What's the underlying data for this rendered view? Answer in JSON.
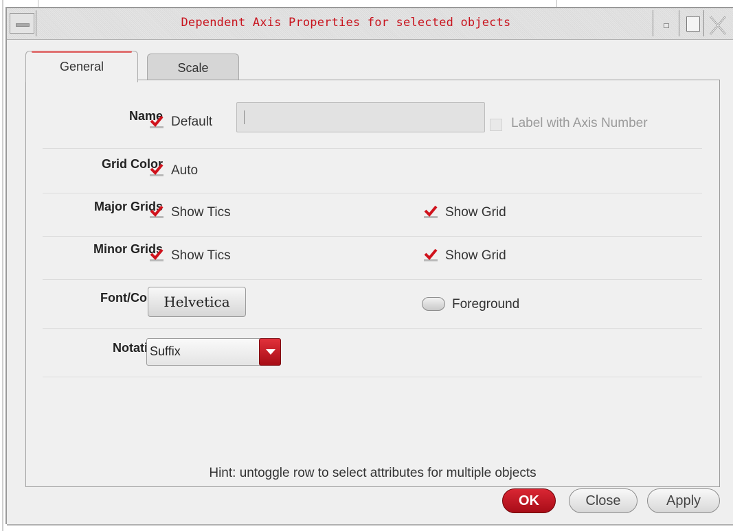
{
  "window": {
    "title": "Dependent Axis Properties for selected objects"
  },
  "tabs": [
    {
      "label": "General",
      "active": true
    },
    {
      "label": "Scale",
      "active": false
    }
  ],
  "form": {
    "name": {
      "label": "Name",
      "default_label": "Default",
      "default_checked": true,
      "value": "",
      "label_with_axis_number": "Label with Axis Number",
      "label_with_axis_number_checked": false,
      "label_with_axis_number_enabled": false
    },
    "grid_color": {
      "label": "Grid Color",
      "auto_label": "Auto",
      "auto_checked": true
    },
    "major_grids": {
      "label": "Major Grids",
      "show_tics_label": "Show Tics",
      "show_tics_checked": true,
      "show_grid_label": "Show Grid",
      "show_grid_checked": true
    },
    "minor_grids": {
      "label": "Minor Grids",
      "show_tics_label": "Show Tics",
      "show_tics_checked": true,
      "show_grid_label": "Show Grid",
      "show_grid_checked": true
    },
    "font_color": {
      "label": "Font/Color",
      "font_button": "Helvetica",
      "color_label": "Foreground"
    },
    "notation": {
      "label": "Notation",
      "selected": "Suffix"
    },
    "hint": "Hint: untoggle row to select attributes for multiple objects"
  },
  "buttons": {
    "ok": "OK",
    "close": "Close",
    "apply": "Apply"
  },
  "colors": {
    "title_text": "#c8141e",
    "check_mark": "#d0121c",
    "ok_button": "#c01521",
    "dropdown_arrow": "#c01521"
  }
}
